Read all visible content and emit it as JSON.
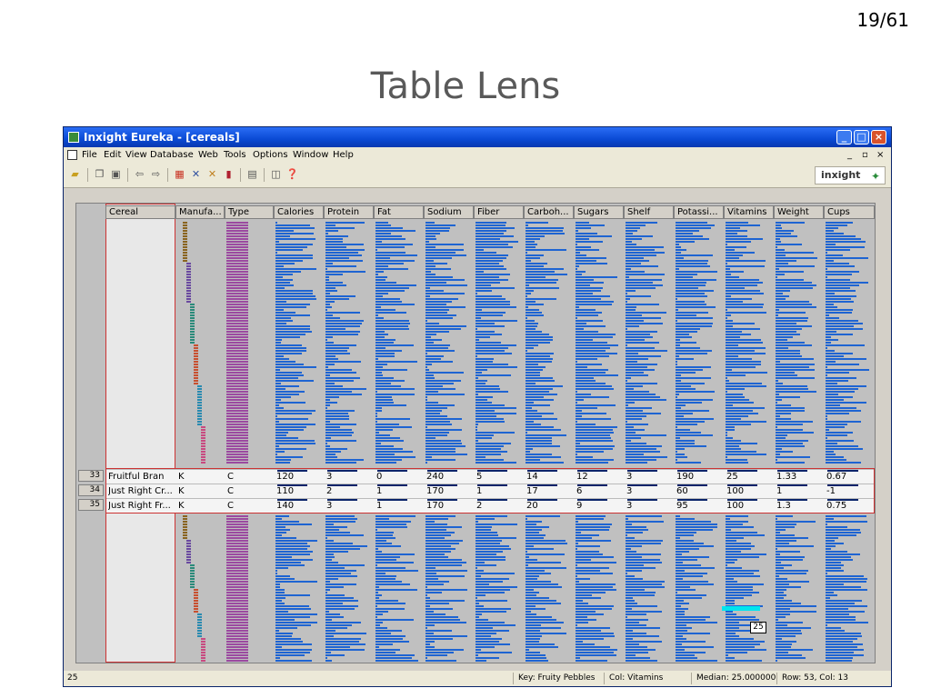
{
  "slide": {
    "number": "19/61",
    "title": "Table Lens"
  },
  "window": {
    "title": "Inxight Eureka - [cereals]"
  },
  "menu": [
    "File",
    "Edit",
    "View",
    "Database",
    "Web",
    "Tools",
    "Options",
    "Window",
    "Help"
  ],
  "toolbar": {
    "logo": "inxight"
  },
  "columns": [
    "Cereal",
    "Manufa...",
    "Type",
    "Calories",
    "Protein",
    "Fat",
    "Sodium",
    "Fiber",
    "Carboh...",
    "Sugars",
    "Shelf",
    "Potassi...",
    "Vitamins",
    "Weight",
    "Cups"
  ],
  "focus_rows": [
    {
      "num": "33",
      "cells": [
        "Fruitful Bran",
        "K",
        "C",
        "120",
        "3",
        "0",
        "240",
        "5",
        "14",
        "12",
        "3",
        "190",
        "25",
        "1.33",
        "0.67"
      ]
    },
    {
      "num": "34",
      "cells": [
        "Just Right Cr...",
        "K",
        "C",
        "110",
        "2",
        "1",
        "170",
        "1",
        "17",
        "6",
        "3",
        "60",
        "100",
        "1",
        "-1"
      ]
    },
    {
      "num": "35",
      "cells": [
        "Just Right Fr...",
        "K",
        "C",
        "140",
        "3",
        "1",
        "170",
        "2",
        "20",
        "9",
        "3",
        "95",
        "100",
        "1.3",
        "0.75"
      ]
    }
  ],
  "median_label": "25",
  "status": {
    "left": "25",
    "key": "Key: Fruity Pebbles",
    "col": "Col: Vitamins",
    "median": "Median: 25.000000",
    "rowcol": "Row: 53, Col: 13"
  },
  "colors": {
    "bar": "#1e64d2",
    "type": "#9b4aa0",
    "selection": "#cc3333",
    "highlight": "#00e5ee"
  }
}
